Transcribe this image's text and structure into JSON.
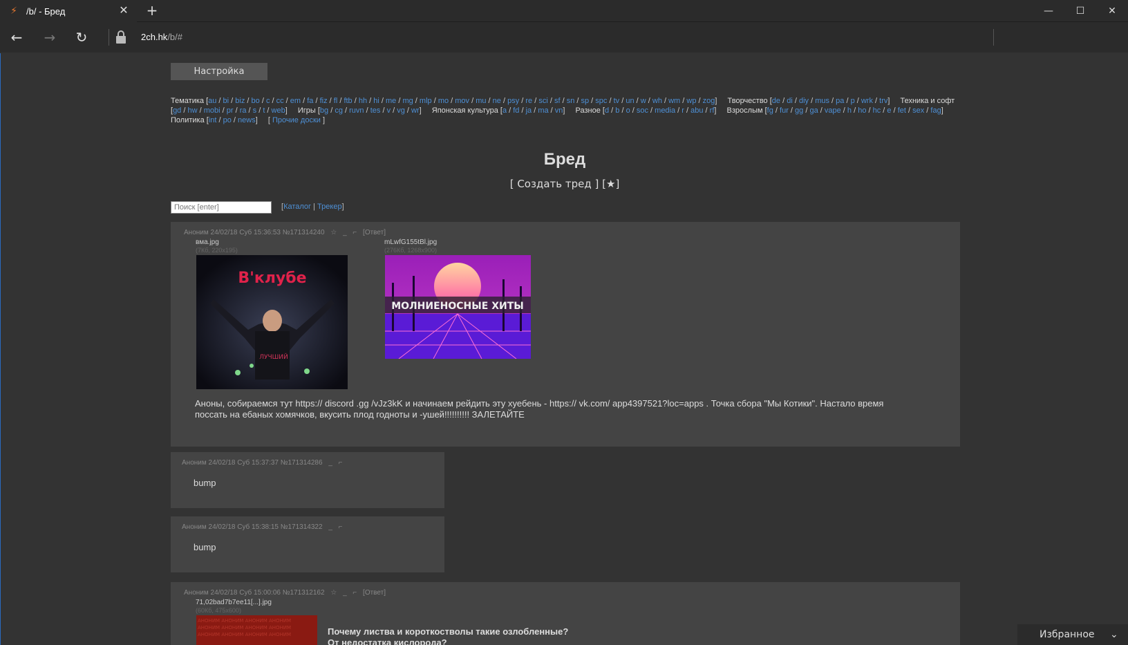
{
  "browser": {
    "tab_title": "/b/ - Бред",
    "url_host": "2ch.hk",
    "url_path": "/b/#",
    "favorites_label": "Избранное"
  },
  "page": {
    "settings_label": "Настройка",
    "boards": [
      {
        "name": "Тематика",
        "items": [
          "au",
          "bi",
          "biz",
          "bo",
          "c",
          "cc",
          "em",
          "fa",
          "fiz",
          "fl",
          "ftb",
          "hh",
          "hi",
          "me",
          "mg",
          "mlp",
          "mo",
          "mov",
          "mu",
          "ne",
          "psy",
          "re",
          "sci",
          "sf",
          "sn",
          "sp",
          "spc",
          "tv",
          "un",
          "w",
          "wh",
          "wm",
          "wp",
          "zog"
        ]
      },
      {
        "name": "Творчество",
        "items": [
          "de",
          "di",
          "diy",
          "mus",
          "pa",
          "p",
          "wrk",
          "trv"
        ]
      },
      {
        "name": "Техника и софт",
        "items": [
          "gd",
          "hw",
          "mobi",
          "pr",
          "ra",
          "s",
          "t",
          "web"
        ]
      },
      {
        "name": "Игры",
        "items": [
          "bg",
          "cg",
          "ruvn",
          "tes",
          "v",
          "vg",
          "wr"
        ]
      },
      {
        "name": "Японская культура",
        "items": [
          "a",
          "fd",
          "ja",
          "ma",
          "vn"
        ]
      },
      {
        "name": "Разное",
        "items": [
          "d",
          "b",
          "o",
          "soc",
          "media",
          "r",
          "abu",
          "rf"
        ]
      },
      {
        "name": "Взрослым",
        "items": [
          "fg",
          "fur",
          "gg",
          "ga",
          "vape",
          "h",
          "ho",
          "hc",
          "e",
          "fet",
          "sex",
          "fag"
        ]
      },
      {
        "name": "Политика",
        "items": [
          "int",
          "po",
          "news"
        ]
      }
    ],
    "other_boards": "Прочие доски",
    "board_title": "Бред",
    "create_thread": "Создать тред",
    "search_placeholder": "Поиск [enter]",
    "catalog": "Каталог",
    "tracker": "Трекер"
  },
  "posts": [
    {
      "meta": "Аноним 24/02/18 Суб 15:36:53  №171314240",
      "reply": "Ответ",
      "files": [
        {
          "name": "вма.jpg",
          "info": "(7Кб, 220x195)"
        },
        {
          "name": "mLwfG155tBl.jpg",
          "info": "(276Кб, 1268x900)"
        }
      ],
      "image1_text": "В'клубе",
      "image2_text": "МОЛНИЕНОСНЫЕ ХИТЫ",
      "text": "Аноны, собираемся тут https:// discord .gg /vJz3kK и начинаем рейдить эту хуебень - https:// vk.com/ app4397521?loc=apps . Точка сбора \"Мы Котики\". Настало время поссать на ебаных хомячков, вкусить плод годноты и -ушей!!!!!!!!!! ЗАЛЕТАЙТЕ"
    },
    {
      "meta": "Аноним 24/02/18 Суб 15:37:37  №171314286",
      "text": "bump"
    },
    {
      "meta": "Аноним 24/02/18 Суб 15:38:15  №171314322",
      "text": "bump"
    },
    {
      "meta": "Аноним 24/02/18 Суб 15:00:06  №171312162",
      "reply": "Ответ",
      "files": [
        {
          "name": "71,02bad7b7ee11[...].jpg",
          "info": "(60Кб, 475x600)"
        }
      ],
      "text_line1": "Почему листва и короткостволы такие озлобленные?",
      "text_line2": "От недостатка кислорода?"
    }
  ]
}
